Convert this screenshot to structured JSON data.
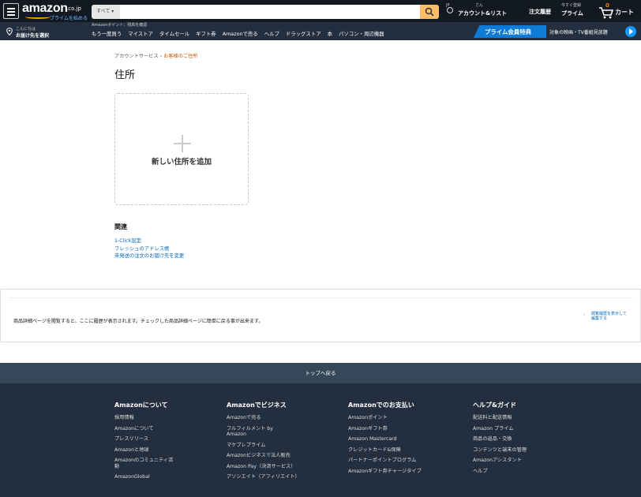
{
  "header": {
    "logo": {
      "word": "amazon",
      "tld": ".co.jp",
      "prime_cta": "プライムを始める"
    },
    "search": {
      "category": "すべて",
      "placeholder": ""
    },
    "language": {
      "code": "JP"
    },
    "account": {
      "greeting": "さん",
      "label": "アカウント&リスト"
    },
    "orders": {
      "label": "注文履歴"
    },
    "prime": {
      "top": "今すぐ登録",
      "label": "プライム"
    },
    "cart": {
      "count": "0",
      "label": "カート"
    }
  },
  "subnav": {
    "deliver": {
      "line1": "こんにちは",
      "line2": "お届け先を選択"
    },
    "points": "Amazonポイント：残高を確認",
    "links": [
      "もう一度買う",
      "マイストア",
      "タイムセール",
      "ギフト券",
      "Amazonで売る",
      "ヘルプ",
      "ドラッグストア",
      "本",
      "パソコン・周辺機器"
    ],
    "prime_banner": "プライム会員特典",
    "prime_tv": "対象の映画・TV番組見放題"
  },
  "main": {
    "breadcrumb": {
      "parent": "アカウントサービス",
      "separator": "›",
      "current": "お客様のご住所"
    },
    "title": "住所",
    "add_address": "新しい住所を追加",
    "related": {
      "heading": "関連",
      "links": [
        "1-Click設定",
        "フレッシュのアドレス帳",
        "未発送の注文のお届け先を変更"
      ]
    }
  },
  "history": {
    "message": "商品詳細ページを閲覧すると、ここに履歴が表示されます。チェックした商品詳細ページに簡単に戻る事が出来ます。",
    "link": "閲覧履歴を表示して編集する"
  },
  "footer": {
    "back_to_top": "トップへ戻る",
    "columns": [
      {
        "heading": "Amazonについて",
        "links": [
          "採用情報",
          "Amazonについて",
          "プレスリリース",
          "Amazonと地球",
          "Amazonのコミュニティ活動",
          "AmazonGlobal"
        ]
      },
      {
        "heading": "Amazonでビジネス",
        "links": [
          "Amazonで売る",
          "フルフィルメント by Amazon",
          "マケプレプライム",
          "Amazonビジネスで法人販売",
          "Amazon Pay（決済サービス）",
          "アソシエイト（アフィリエイト）"
        ]
      },
      {
        "heading": "Amazonでのお支払い",
        "links": [
          "Amazonポイント",
          "Amazonギフト券",
          "Amazon Mastercard",
          "クレジットカード&保険",
          "パートナーポイントプログラム",
          "Amazonギフト券チャージタイプ"
        ]
      },
      {
        "heading": "ヘルプ&ガイド",
        "links": [
          "配送料と配送情報",
          "Amazon プライム",
          "商品の返品・交換",
          "コンテンツと端末の管理",
          "Amazonアシスタント",
          "ヘルプ"
        ]
      }
    ]
  }
}
